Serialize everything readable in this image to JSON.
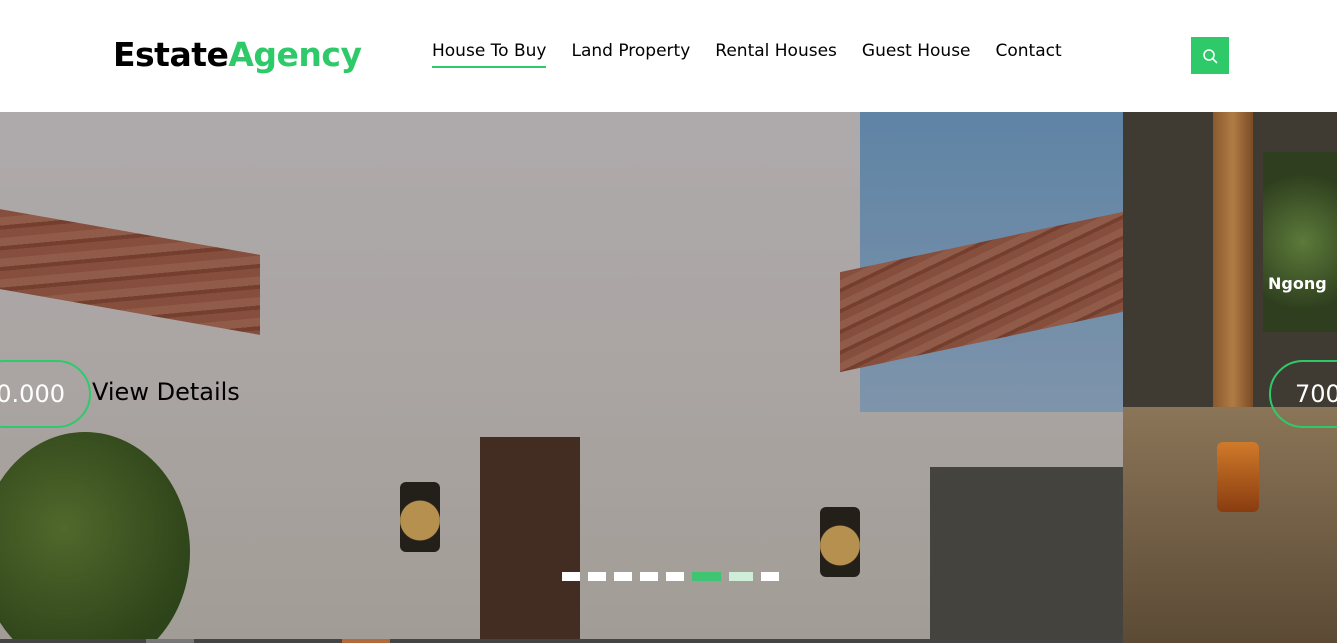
{
  "header": {
    "brand_part1": "Estate",
    "brand_part2": "Agency",
    "nav": [
      "House To Buy",
      "Land Property",
      "Rental Houses",
      "Guest House",
      "Contact"
    ],
    "active_nav": "House To Buy",
    "search_icon": "search-icon"
  },
  "hero": {
    "current_slide": {
      "price": "0.000",
      "link": "View Details"
    },
    "next_slide": {
      "city": "Ngong",
      "price": "700"
    },
    "carousel_dots_count": 8,
    "active_dot_index": 5
  },
  "colors": {
    "accent": "#2eca6a",
    "text": "#000000"
  }
}
